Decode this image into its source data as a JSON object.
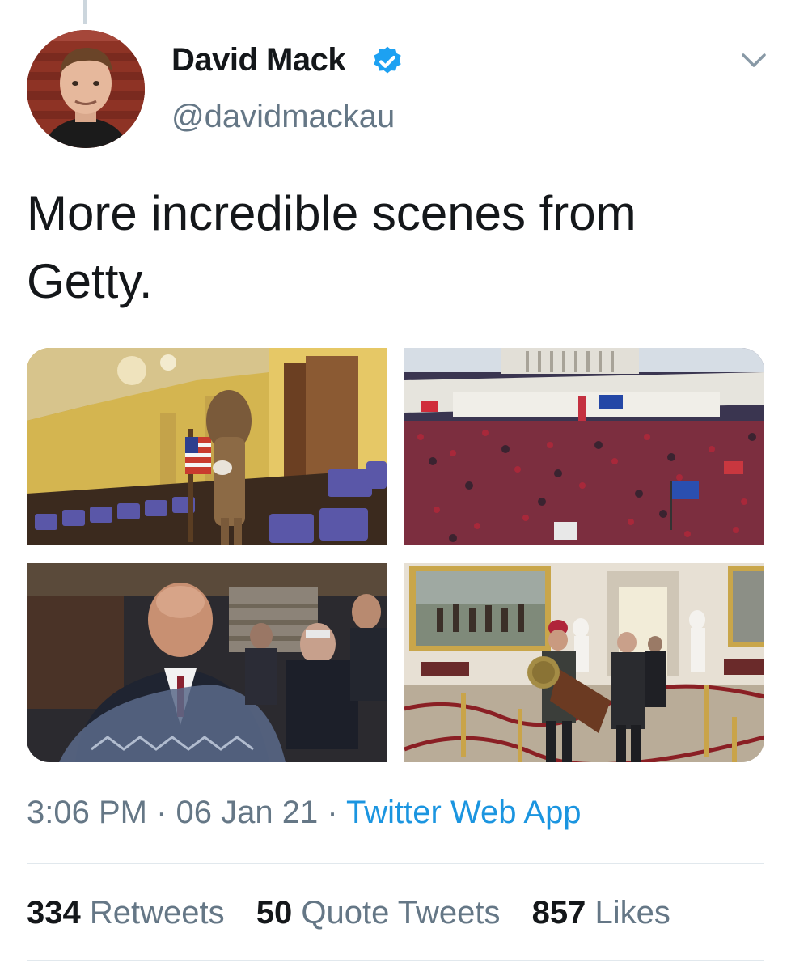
{
  "author": {
    "name": "David Mack",
    "handle": "@davidmackau",
    "verified": true,
    "verified_color": "#1da1f2"
  },
  "tweet": {
    "text": "More incredible scenes from Getty."
  },
  "media": [
    {
      "name": "photo-chamber-balcony"
    },
    {
      "name": "photo-capitol-crowd"
    },
    {
      "name": "photo-lawmakers-sheltering"
    },
    {
      "name": "photo-rotunda-lectern"
    }
  ],
  "meta": {
    "time": "3:06 PM",
    "sep": " · ",
    "date": "06 Jan 21",
    "source": "Twitter Web App",
    "source_color": "#1b95e0"
  },
  "stats": {
    "retweets_count": "334",
    "retweets_label": "Retweets",
    "quotes_count": "50",
    "quotes_label": "Quote Tweets",
    "likes_count": "857",
    "likes_label": "Likes"
  },
  "icons": {
    "verified": "verified-badge-icon",
    "more": "chevron-down-icon"
  }
}
